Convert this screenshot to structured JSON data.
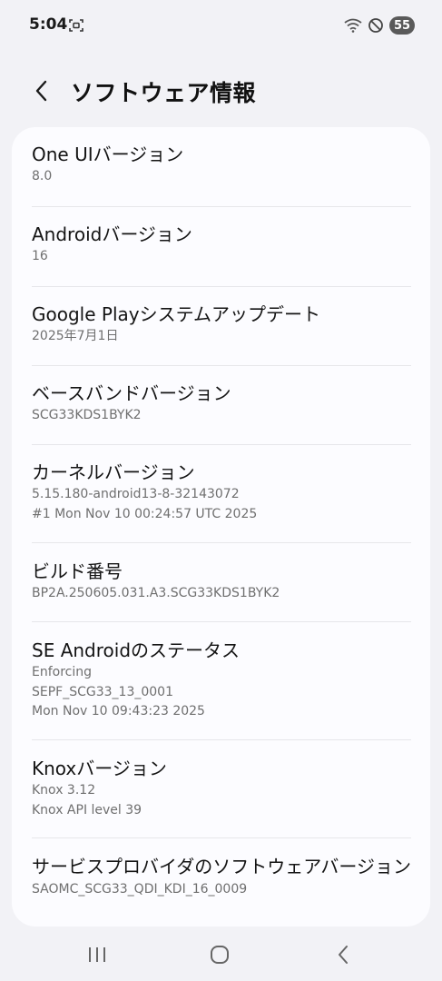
{
  "status_bar": {
    "time": "5:04",
    "battery_level": "55",
    "icons": [
      "screenshot-scan-icon",
      "wifi-icon",
      "do-not-disturb-icon",
      "battery-icon"
    ]
  },
  "header": {
    "title": "ソフトウェア情報",
    "back_icon": "chevron-left-icon"
  },
  "items": [
    {
      "title": "One UIバージョン",
      "lines": [
        "8.0"
      ]
    },
    {
      "title": "Androidバージョン",
      "lines": [
        "16"
      ]
    },
    {
      "title": "Google Playシステムアップデート",
      "lines": [
        "2025年7月1日"
      ]
    },
    {
      "title": "ベースバンドバージョン",
      "lines": [
        "SCG33KDS1BYK2"
      ]
    },
    {
      "title": "カーネルバージョン",
      "lines": [
        "5.15.180-android13-8-32143072",
        "#1 Mon Nov 10 00:24:57 UTC 2025"
      ]
    },
    {
      "title": "ビルド番号",
      "lines": [
        "BP2A.250605.031.A3.SCG33KDS1BYK2"
      ]
    },
    {
      "title": "SE Androidのステータス",
      "lines": [
        "Enforcing",
        "SEPF_SCG33_13_0001",
        "Mon Nov 10 09:43:23 2025"
      ]
    },
    {
      "title": "Knoxバージョン",
      "lines": [
        "Knox 3.12",
        "Knox API level 39"
      ]
    },
    {
      "title": "サービスプロバイダのソフトウェアバージョン",
      "lines": [
        "SAOMC_SCG33_QDI_KDI_16_0009"
      ]
    }
  ],
  "nav_bar": {
    "icons": [
      "recent-apps-icon",
      "home-icon",
      "back-icon"
    ]
  }
}
